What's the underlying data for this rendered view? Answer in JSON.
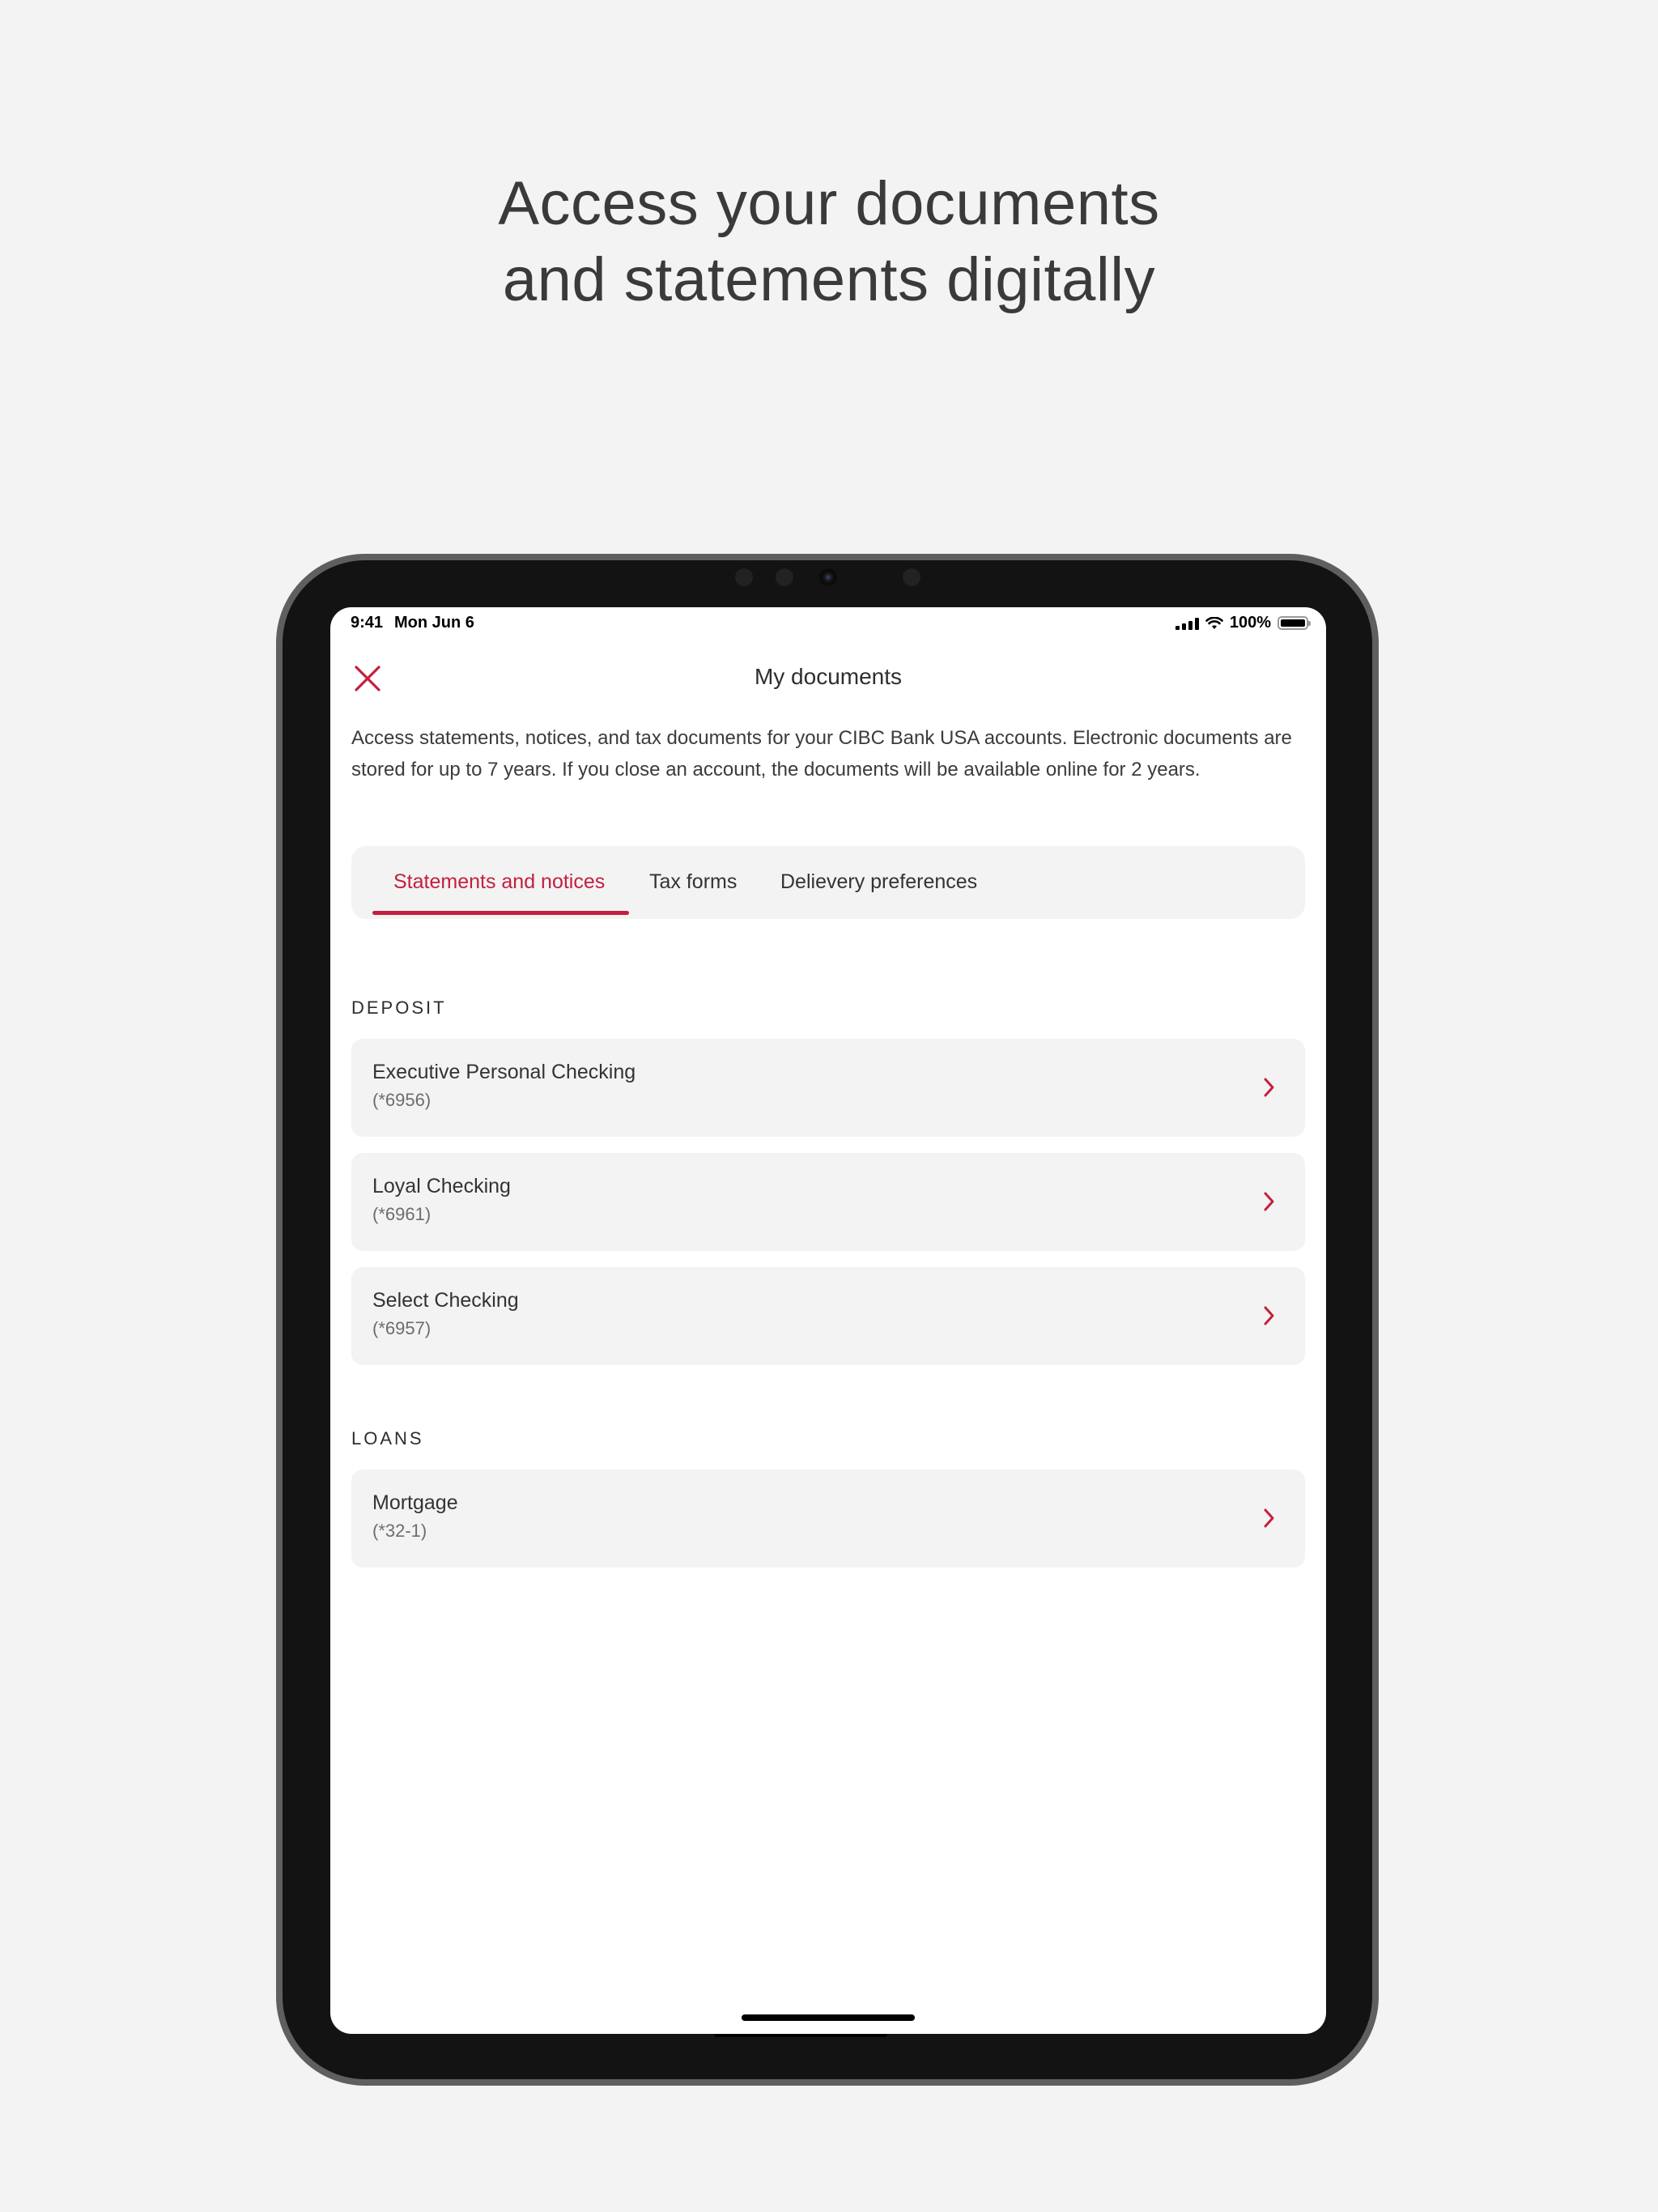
{
  "headline": {
    "line1": "Access your documents",
    "line2": "and statements digitally"
  },
  "status_bar": {
    "time": "9:41",
    "date": "Mon Jun 6",
    "battery": "100%"
  },
  "screen": {
    "title": "My documents",
    "intro": "Access statements, notices, and tax documents for your CIBC Bank USA accounts. Electronic documents are stored for up to 7 years. If you close an account, the documents will be available online for 2 years.",
    "tabs": [
      {
        "label": "Statements and notices",
        "active": true
      },
      {
        "label": "Tax forms",
        "active": false
      },
      {
        "label": "Delievery preferences",
        "active": false
      }
    ],
    "sections": [
      {
        "label": "DEPOSIT",
        "accounts": [
          {
            "name": "Executive Personal Checking",
            "number": "(*6956)"
          },
          {
            "name": "Loyal Checking",
            "number": "(*6961)"
          },
          {
            "name": "Select Checking",
            "number": "(*6957)"
          }
        ]
      },
      {
        "label": "LOANS",
        "accounts": [
          {
            "name": "Mortgage",
            "number": "(*32-1)"
          }
        ]
      }
    ]
  },
  "icons": {
    "close": "close-icon",
    "chevron": "chevron-right-icon",
    "signal": "cellular-signal-icon",
    "wifi": "wifi-icon",
    "battery": "battery-icon"
  },
  "colors": {
    "accent": "#c41f3e",
    "background": "#f3f3f3",
    "card": "#f3f3f3",
    "screen": "#ffffff"
  }
}
